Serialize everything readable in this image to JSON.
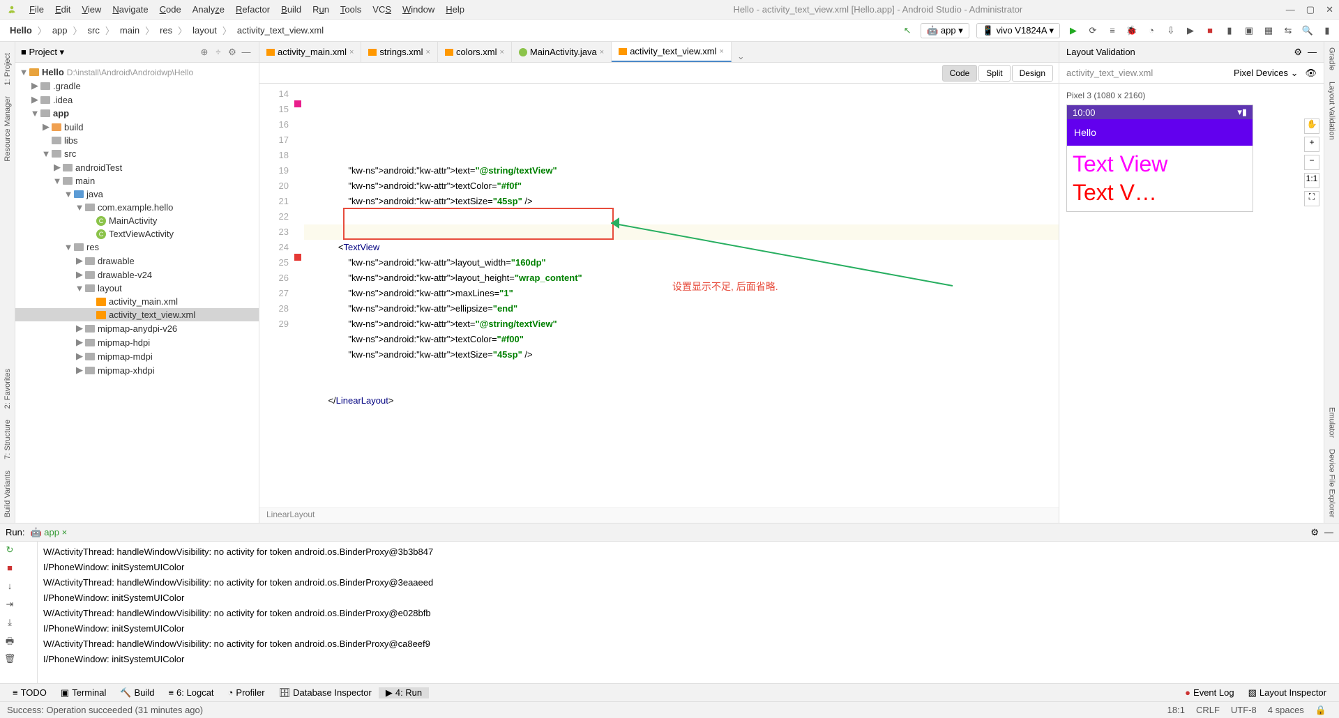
{
  "window": {
    "title": "Hello - activity_text_view.xml [Hello.app] - Android Studio - Administrator"
  },
  "menu": [
    "File",
    "Edit",
    "View",
    "Navigate",
    "Code",
    "Analyze",
    "Refactor",
    "Build",
    "Run",
    "Tools",
    "VCS",
    "Window",
    "Help"
  ],
  "breadcrumb": [
    "Hello",
    "app",
    "src",
    "main",
    "res",
    "layout",
    "activity_text_view.xml"
  ],
  "device_selects": {
    "module": "app",
    "device": "vivo V1824A"
  },
  "project": {
    "title": "Project",
    "root": {
      "name": "Hello",
      "path": "D:\\install\\Android\\Androidwp\\Hello"
    },
    "tree": [
      {
        "l": 1,
        "name": ".gradle",
        "type": "folder-dark",
        "arrow": "▶"
      },
      {
        "l": 1,
        "name": ".idea",
        "type": "folder-dark",
        "arrow": "▶"
      },
      {
        "l": 1,
        "name": "app",
        "type": "folder",
        "arrow": "▼",
        "bold": true
      },
      {
        "l": 2,
        "name": "build",
        "type": "folder-orange",
        "arrow": "▶"
      },
      {
        "l": 2,
        "name": "libs",
        "type": "folder-gray",
        "arrow": ""
      },
      {
        "l": 2,
        "name": "src",
        "type": "folder-gray",
        "arrow": "▼"
      },
      {
        "l": 3,
        "name": "androidTest",
        "type": "folder-gray",
        "arrow": "▶"
      },
      {
        "l": 3,
        "name": "main",
        "type": "folder-gray",
        "arrow": "▼"
      },
      {
        "l": 4,
        "name": "java",
        "type": "folder-blue",
        "arrow": "▼"
      },
      {
        "l": 5,
        "name": "com.example.hello",
        "type": "folder-gray",
        "arrow": "▼"
      },
      {
        "l": 6,
        "name": "MainActivity",
        "type": "class",
        "arrow": ""
      },
      {
        "l": 6,
        "name": "TextViewActivity",
        "type": "class",
        "arrow": ""
      },
      {
        "l": 4,
        "name": "res",
        "type": "folder-gray",
        "arrow": "▼"
      },
      {
        "l": 5,
        "name": "drawable",
        "type": "folder-gray",
        "arrow": "▶"
      },
      {
        "l": 5,
        "name": "drawable-v24",
        "type": "folder-gray",
        "arrow": "▶"
      },
      {
        "l": 5,
        "name": "layout",
        "type": "folder-gray",
        "arrow": "▼"
      },
      {
        "l": 6,
        "name": "activity_main.xml",
        "type": "xml",
        "arrow": ""
      },
      {
        "l": 6,
        "name": "activity_text_view.xml",
        "type": "xml",
        "arrow": "",
        "selected": true
      },
      {
        "l": 5,
        "name": "mipmap-anydpi-v26",
        "type": "folder-gray",
        "arrow": "▶"
      },
      {
        "l": 5,
        "name": "mipmap-hdpi",
        "type": "folder-gray",
        "arrow": "▶"
      },
      {
        "l": 5,
        "name": "mipmap-mdpi",
        "type": "folder-gray",
        "arrow": "▶"
      },
      {
        "l": 5,
        "name": "mipmap-xhdpi",
        "type": "folder-gray",
        "arrow": "▶"
      }
    ]
  },
  "editor": {
    "tabs": [
      {
        "label": "activity_main.xml",
        "icon": "xml"
      },
      {
        "label": "strings.xml",
        "icon": "xml"
      },
      {
        "label": "colors.xml",
        "icon": "xml"
      },
      {
        "label": "MainActivity.java",
        "icon": "class"
      },
      {
        "label": "activity_text_view.xml",
        "icon": "xml",
        "active": true
      }
    ],
    "view_modes": {
      "code": "Code",
      "split": "Split",
      "design": "Design"
    },
    "line_start": 14,
    "lines": [
      "            android:text=\"@string/textView\"",
      "            android:textColor=\"#f0f\"",
      "            android:textSize=\"45sp\" />",
      "",
      "",
      "        <TextView",
      "            android:layout_width=\"160dp\"",
      "            android:layout_height=\"wrap_content\"",
      "            android:maxLines=\"1\"",
      "            android:ellipsize=\"end\"",
      "            android:text=\"@string/textView\"",
      "            android:textColor=\"#f00\"",
      "            android:textSize=\"45sp\" />",
      "",
      "",
      "    </LinearLayout>"
    ],
    "markers": {
      "15": "#e91e8c",
      "25": "#e53935"
    },
    "breadcrumb_bottom": "LinearLayout",
    "annotation": "设置显示不足, 后面省略."
  },
  "layout_validation": {
    "title": "Layout Validation",
    "file": "activity_text_view.xml",
    "device_dropdown": "Pixel Devices",
    "device_label": "Pixel 3 (1080 x 2160)",
    "phone": {
      "status_time": "10:00",
      "app_title": "Hello",
      "text1": "Text View",
      "text2": "Text V…"
    }
  },
  "run": {
    "title": "Run:",
    "config": "app",
    "console_lines": [
      "W/ActivityThread: handleWindowVisibility: no activity for token android.os.BinderProxy@3b3b847",
      "I/PhoneWindow: initSystemUIColor",
      "W/ActivityThread: handleWindowVisibility: no activity for token android.os.BinderProxy@3eaaeed",
      "I/PhoneWindow: initSystemUIColor",
      "W/ActivityThread: handleWindowVisibility: no activity for token android.os.BinderProxy@e028bfb",
      "I/PhoneWindow: initSystemUIColor",
      "W/ActivityThread: handleWindowVisibility: no activity for token android.os.BinderProxy@ca8eef9",
      "I/PhoneWindow: initSystemUIColor"
    ]
  },
  "bottom_tabs": [
    "TODO",
    "Terminal",
    "Build",
    "6: Logcat",
    "Profiler",
    "Database Inspector",
    "4: Run"
  ],
  "bottom_right": [
    "Event Log",
    "Layout Inspector"
  ],
  "left_rail": [
    "1: Project",
    "Resource Manager"
  ],
  "left_rail2": [
    "2: Favorites",
    "7: Structure",
    "Build Variants"
  ],
  "right_rail": [
    "Gradle",
    "Layout Validation"
  ],
  "right_rail2": [
    "Emulator",
    "Device File Explorer"
  ],
  "status": {
    "msg": "Success: Operation succeeded (31 minutes ago)",
    "pos": "18:1",
    "eol": "CRLF",
    "enc": "UTF-8",
    "indent": "4 spaces"
  }
}
